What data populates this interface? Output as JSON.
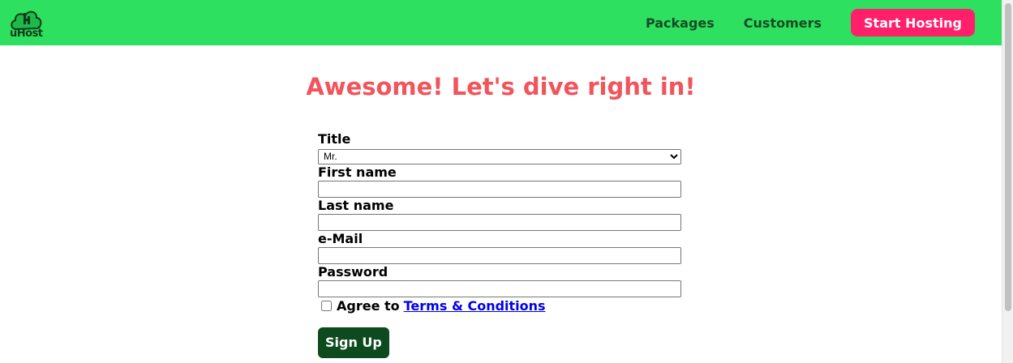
{
  "brand": {
    "logo_text": "uHost",
    "header_color": "#2ee05f",
    "accent_color": "#ff1f6b",
    "heading_color": "#f2545b",
    "button_color": "#0d4a1d"
  },
  "nav": {
    "links": [
      "Packages",
      "Customers"
    ],
    "cta_label": "Start Hosting"
  },
  "heading": "Awesome! Let's dive right in!",
  "form": {
    "title_label": "Title",
    "title_options": [
      "Mr."
    ],
    "title_selected": "Mr.",
    "first_name_label": "First name",
    "first_name_value": "",
    "last_name_label": "Last name",
    "last_name_value": "",
    "email_label": "e-Mail",
    "email_value": "",
    "password_label": "Password",
    "password_value": "",
    "agree_text": "Agree to",
    "agree_link": "Terms & Conditions",
    "agree_checked": false,
    "submit_label": "Sign Up"
  }
}
